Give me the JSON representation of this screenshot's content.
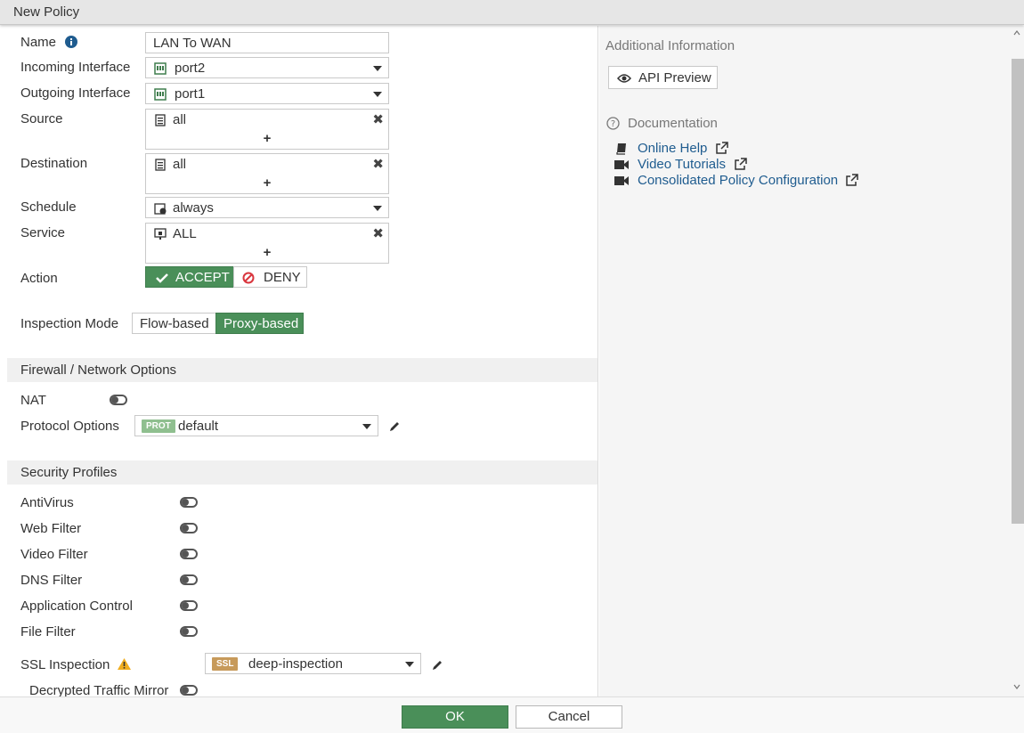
{
  "window": {
    "title": "New Policy"
  },
  "form": {
    "name": {
      "label": "Name",
      "value": "LAN To WAN"
    },
    "incoming": {
      "label": "Incoming Interface",
      "value": "port2"
    },
    "outgoing": {
      "label": "Outgoing Interface",
      "value": "port1"
    },
    "source": {
      "label": "Source",
      "value": "all"
    },
    "destination": {
      "label": "Destination",
      "value": "all"
    },
    "schedule": {
      "label": "Schedule",
      "value": "always"
    },
    "service": {
      "label": "Service",
      "value": "ALL"
    },
    "action": {
      "label": "Action",
      "accept": "ACCEPT",
      "deny": "DENY",
      "selected": "ACCEPT"
    },
    "inspection_mode": {
      "label": "Inspection Mode",
      "options": [
        "Flow-based",
        "Proxy-based"
      ],
      "selected": "Proxy-based"
    }
  },
  "firewall_section": {
    "title": "Firewall / Network Options",
    "nat": {
      "label": "NAT",
      "enabled": false
    },
    "protocol_options": {
      "label": "Protocol Options",
      "badge": "PROT",
      "value": "default"
    }
  },
  "security_section": {
    "title": "Security Profiles",
    "profiles": [
      {
        "label": "AntiVirus",
        "enabled": false
      },
      {
        "label": "Web Filter",
        "enabled": false
      },
      {
        "label": "Video Filter",
        "enabled": false
      },
      {
        "label": "DNS Filter",
        "enabled": false
      },
      {
        "label": "Application Control",
        "enabled": false
      },
      {
        "label": "File Filter",
        "enabled": false
      }
    ],
    "ssl_inspection": {
      "label": "SSL Inspection",
      "badge": "SSL",
      "value": "deep-inspection"
    },
    "decrypted_mirror": {
      "label": "Decrypted Traffic Mirror",
      "enabled": false
    }
  },
  "sidebar": {
    "additional_info": "Additional Information",
    "api_preview": "API Preview",
    "documentation": "Documentation",
    "links": [
      "Online Help",
      "Video Tutorials",
      "Consolidated Policy Configuration"
    ]
  },
  "footer": {
    "ok": "OK",
    "cancel": "Cancel"
  },
  "colors": {
    "accent_green": "#4a8f59",
    "link_blue": "#1f5c8f",
    "deny_red": "#d9363e",
    "warning_yellow": "#f0ad1e",
    "prot_badge": "#8fbf8f",
    "ssl_badge": "#c79a5a"
  }
}
